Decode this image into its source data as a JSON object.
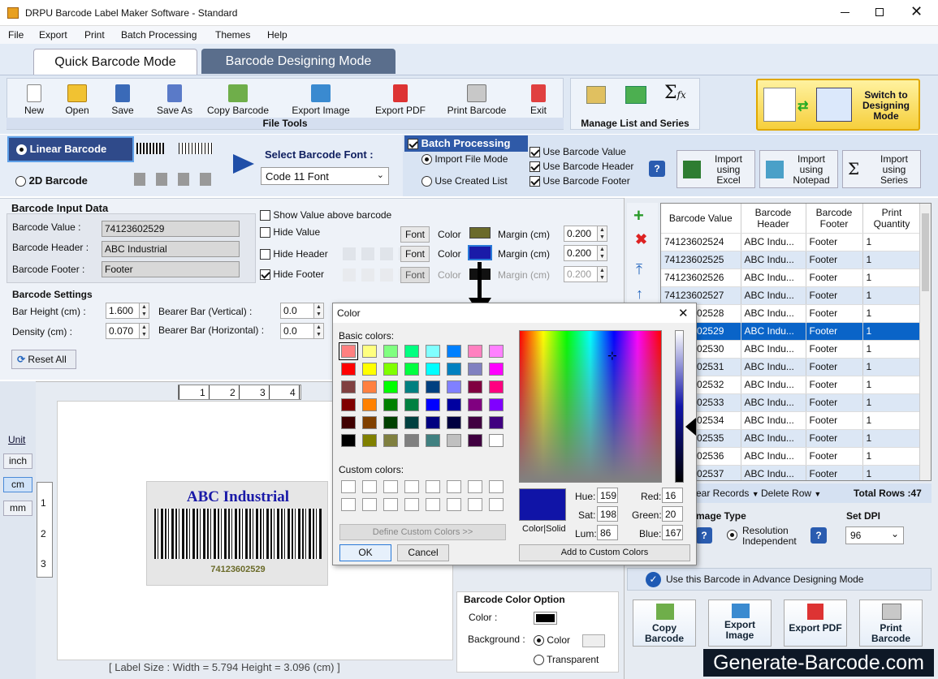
{
  "window": {
    "title": "DRPU Barcode Label Maker Software - Standard"
  },
  "menu": [
    "File",
    "Export",
    "Print",
    "Batch Processing",
    "Themes",
    "Help"
  ],
  "tabs": {
    "quick": "Quick Barcode Mode",
    "designing": "Barcode Designing Mode"
  },
  "toolbar": {
    "new": "New",
    "open": "Open",
    "save": "Save",
    "save_as": "Save As",
    "copy_barcode": "Copy Barcode",
    "export_image": "Export Image",
    "export_pdf": "Export PDF",
    "print_barcode": "Print Barcode",
    "exit": "Exit",
    "file_tools": "File Tools",
    "manage": "Manage List and Series",
    "switch": "Switch to Designing Mode"
  },
  "type": {
    "linear": "Linear Barcode",
    "twod": "2D Barcode"
  },
  "font": {
    "label": "Select Barcode Font :",
    "value": "Code 11 Font"
  },
  "batch": {
    "title": "Batch Processing",
    "import_file": "Import File Mode",
    "use_created": "Use Created List",
    "use_value": "Use Barcode Value",
    "use_header": "Use Barcode Header",
    "use_footer": "Use Barcode Footer",
    "import_excel": "Import using Excel",
    "import_notepad": "Import using Notepad",
    "import_series": "Import using Series"
  },
  "input": {
    "title": "Barcode Input Data",
    "value_label": "Barcode Value :",
    "value": "74123602529",
    "header_label": "Barcode Header :",
    "header": "ABC Industrial",
    "footer_label": "Barcode Footer :",
    "footer": "Footer",
    "show_above": "Show Value above barcode",
    "hide_value": "Hide Value",
    "hide_header": "Hide Header",
    "hide_footer": "Hide Footer",
    "font_btn": "Font",
    "color": "Color",
    "margin": "Margin (cm)",
    "m1": "0.200",
    "m2": "0.200",
    "m3": "0.200",
    "color_header": "#1a1aa8",
    "color_value": "#6b6b2a"
  },
  "settings": {
    "title": "Barcode Settings",
    "bar_height": "Bar Height (cm) :",
    "bar_height_v": "1.600",
    "density": "Density (cm) :",
    "density_v": "0.070",
    "bearer_v": "Bearer Bar (Vertical) :",
    "bearer_v_v": "0.0",
    "bearer_h": "Bearer Bar (Horizontal) :",
    "bearer_h_v": "0.0",
    "reset": "Reset All"
  },
  "units": {
    "unit": "Unit",
    "inch": "inch",
    "cm": "cm",
    "mm": "mm"
  },
  "ruler": {
    "h": [
      "1",
      "2",
      "3",
      "4"
    ],
    "v": [
      "1",
      "2",
      "3"
    ]
  },
  "preview": {
    "header": "ABC Industrial",
    "value": "74123602529",
    "status": "[ Label Size : Width = 5.794  Height = 3.096 (cm) ]"
  },
  "grid": {
    "cols": [
      "Barcode Value",
      "Barcode Header",
      "Barcode Footer",
      "Print Quantity"
    ],
    "rows": [
      [
        "74123602524",
        "ABC Indu...",
        "Footer",
        "1"
      ],
      [
        "74123602525",
        "ABC Indu...",
        "Footer",
        "1"
      ],
      [
        "74123602526",
        "ABC Indu...",
        "Footer",
        "1"
      ],
      [
        "74123602527",
        "ABC Indu...",
        "Footer",
        "1"
      ],
      [
        "74123602528",
        "ABC Indu...",
        "Footer",
        "1"
      ],
      [
        "74123602529",
        "ABC Indu...",
        "Footer",
        "1"
      ],
      [
        "74123602530",
        "ABC Indu...",
        "Footer",
        "1"
      ],
      [
        "74123602531",
        "ABC Indu...",
        "Footer",
        "1"
      ],
      [
        "74123602532",
        "ABC Indu...",
        "Footer",
        "1"
      ],
      [
        "74123602533",
        "ABC Indu...",
        "Footer",
        "1"
      ],
      [
        "74123602534",
        "ABC Indu...",
        "Footer",
        "1"
      ],
      [
        "74123602535",
        "ABC Indu...",
        "Footer",
        "1"
      ],
      [
        "74123602536",
        "ABC Indu...",
        "Footer",
        "1"
      ],
      [
        "74123602537",
        "ABC Indu...",
        "Footer",
        "1"
      ]
    ],
    "clear": "ear Records",
    "delete": "Delete Row",
    "total": "Total Rows :47"
  },
  "image_type": {
    "title": "mage Type",
    "resolution": "Resolution Independent"
  },
  "dpi": {
    "title": "Set DPI",
    "value": "96"
  },
  "advance": "Use this Barcode in Advance Designing Mode",
  "actions": {
    "copy": "Copy Barcode",
    "export_image": "Export Image",
    "export_pdf": "Export PDF",
    "print": "Print Barcode"
  },
  "color_option": {
    "title": "Barcode Color Option",
    "color": "Color :",
    "background": "Background :",
    "color_radio": "Color",
    "transparent": "Transparent"
  },
  "watermark": "Generate-Barcode.com",
  "dialog": {
    "title": "Color",
    "basic": "Basic colors:",
    "custom": "Custom colors:",
    "define": "Define Custom Colors >>",
    "ok": "OK",
    "cancel": "Cancel",
    "colorsolid": "Color|Solid",
    "hue": "Hue:",
    "hue_v": "159",
    "sat": "Sat:",
    "sat_v": "198",
    "lum": "Lum:",
    "lum_v": "86",
    "red": "Red:",
    "red_v": "16",
    "green": "Green:",
    "green_v": "20",
    "blue": "Blue:",
    "blue_v": "167",
    "add": "Add to Custom Colors",
    "basic_colors": [
      "#ff8080",
      "#ffff80",
      "#80ff80",
      "#00ff80",
      "#80ffff",
      "#0080ff",
      "#ff80c0",
      "#ff80ff",
      "#ff0000",
      "#ffff00",
      "#80ff00",
      "#00ff40",
      "#00ffff",
      "#0080c0",
      "#8080c0",
      "#ff00ff",
      "#804040",
      "#ff8040",
      "#00ff00",
      "#008080",
      "#004080",
      "#8080ff",
      "#800040",
      "#ff0080",
      "#800000",
      "#ff8000",
      "#008000",
      "#008040",
      "#0000ff",
      "#0000a0",
      "#800080",
      "#8000ff",
      "#400000",
      "#804000",
      "#004000",
      "#004040",
      "#000080",
      "#000040",
      "#400040",
      "#400080",
      "#000000",
      "#808000",
      "#808040",
      "#808080",
      "#408080",
      "#c0c0c0",
      "#400040",
      "#ffffff"
    ],
    "selected": "#1014a7"
  }
}
